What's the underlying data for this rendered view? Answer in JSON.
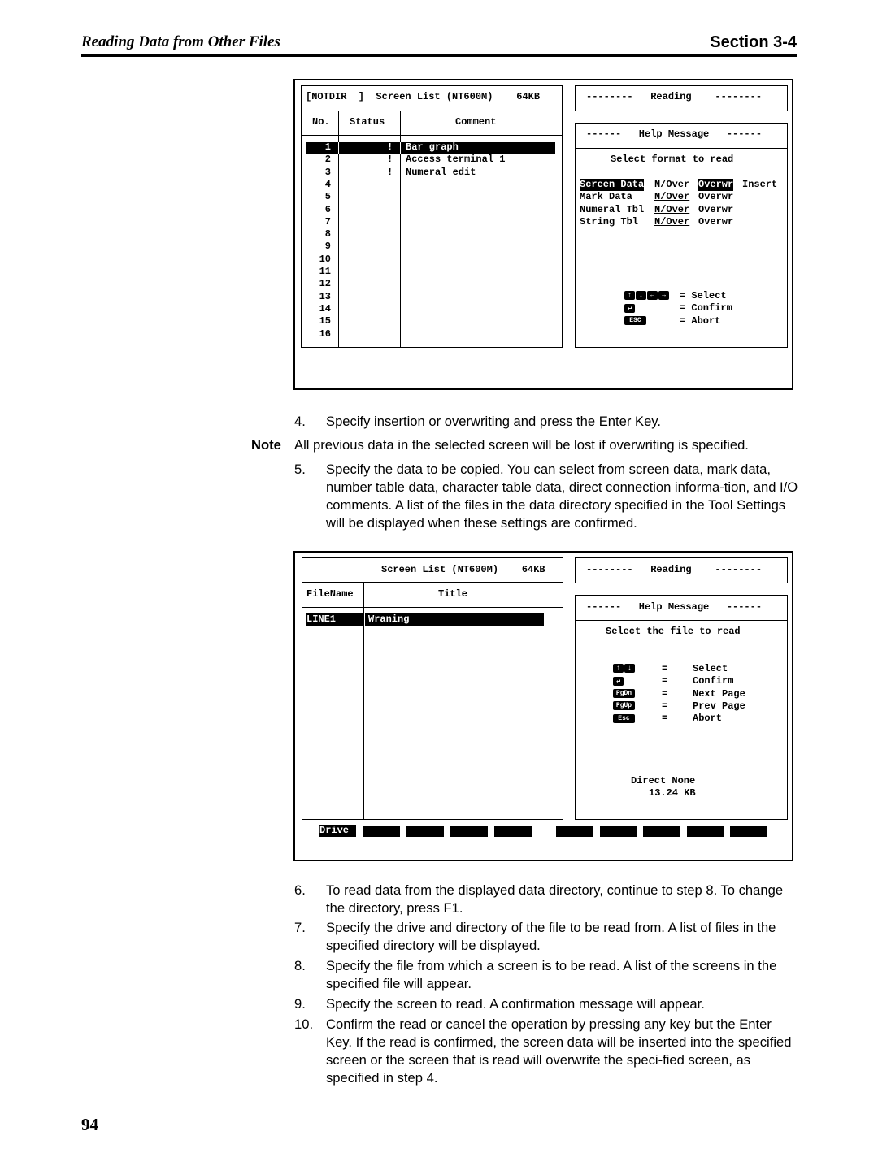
{
  "header": {
    "title": "Reading Data from Other Files",
    "section": "Section 3-4"
  },
  "screen1": {
    "list_title": "[NOTDIR  ]  Screen List (NT600M)    64KB",
    "columns": {
      "no": "No.",
      "status": "Status",
      "comment": "Comment"
    },
    "rows": [
      {
        "no": "1",
        "status": "!",
        "comment": "Bar graph",
        "selected": true
      },
      {
        "no": "2",
        "status": "!",
        "comment": "Access terminal 1"
      },
      {
        "no": "3",
        "status": "!",
        "comment": "Numeral edit"
      },
      {
        "no": "4"
      },
      {
        "no": "5"
      },
      {
        "no": "6"
      },
      {
        "no": "7"
      },
      {
        "no": "8"
      },
      {
        "no": "9"
      },
      {
        "no": "10"
      },
      {
        "no": "11"
      },
      {
        "no": "12"
      },
      {
        "no": "13"
      },
      {
        "no": "14"
      },
      {
        "no": "15"
      },
      {
        "no": "16"
      }
    ],
    "reading": "--------   Reading    --------",
    "help_title": "------   Help Message   ------",
    "help_prompt": "Select format to read",
    "formats": [
      {
        "name": "Screen Data",
        "opts": [
          "N/Over",
          "Overwr",
          "Insert"
        ]
      },
      {
        "name": "Mark Data",
        "opts": [
          "N/Over",
          "Overwr"
        ]
      },
      {
        "name": "Numeral Tbl",
        "opts": [
          "N/Over",
          "Overwr"
        ]
      },
      {
        "name": "String Tbl",
        "opts": [
          "N/Over",
          "Overwr"
        ]
      }
    ],
    "legend": [
      {
        "keys": [
          "↑",
          "↓",
          "←",
          "→"
        ],
        "label": "= Select"
      },
      {
        "keys": [
          "↵"
        ],
        "label": "= Confirm"
      },
      {
        "keys": [
          "ESC"
        ],
        "label": "= Abort"
      }
    ]
  },
  "screen2": {
    "list_title": "Screen List (NT600M)    64KB",
    "columns": {
      "filename": "FileName",
      "title": "Title"
    },
    "rows": [
      {
        "filename": "LINE1",
        "title": "Wraning",
        "selected": true
      }
    ],
    "reading": "--------   Reading    --------",
    "help_title": "------   Help Message   ------",
    "help_prompt": "Select the file to read",
    "legend": [
      {
        "keys": [
          "↑",
          "↓"
        ],
        "label": "Select"
      },
      {
        "keys": [
          "↵"
        ],
        "label": "Confirm"
      },
      {
        "keys": [
          "PgDn"
        ],
        "label": "Next Page"
      },
      {
        "keys": [
          "PgUp"
        ],
        "label": "Prev Page"
      },
      {
        "keys": [
          "Esc"
        ],
        "label": "Abort"
      }
    ],
    "direct": "Direct None",
    "size": "13.24 KB",
    "fkey_drive": "Drive"
  },
  "body": {
    "step4": {
      "num": "4.",
      "text": "Specify insertion or overwriting and press the Enter Key."
    },
    "note": {
      "label": "Note",
      "text": "All previous data in the selected screen will be lost if overwriting is specified."
    },
    "step5": {
      "num": "5.",
      "text": "Specify the data to be copied. You can select from screen data, mark data, number table data, character table data, direct connection informa-tion, and I/O comments. A list of the files in the data directory specified in the Tool Settings will be displayed when these settings are confirmed."
    },
    "step6": {
      "num": "6.",
      "text": "To read data from the displayed data directory, continue to step 8. To change the directory, press F1."
    },
    "step7": {
      "num": "7.",
      "text": "Specify the drive and directory of the file to be read from. A list of files in the specified directory will be displayed."
    },
    "step8": {
      "num": "8.",
      "text": "Specify the file from which a screen is to be read. A list of the screens in the specified file will appear."
    },
    "step9": {
      "num": "9.",
      "text": "Specify the screen to read. A confirmation message will appear."
    },
    "step10": {
      "num": "10.",
      "text": "Confirm the read or cancel the operation by pressing any key but the Enter Key. If the read is confirmed, the screen data will be inserted into the specified screen or the screen that is read will overwrite the speci-fied screen, as specified in step 4."
    }
  },
  "page_number": "94"
}
